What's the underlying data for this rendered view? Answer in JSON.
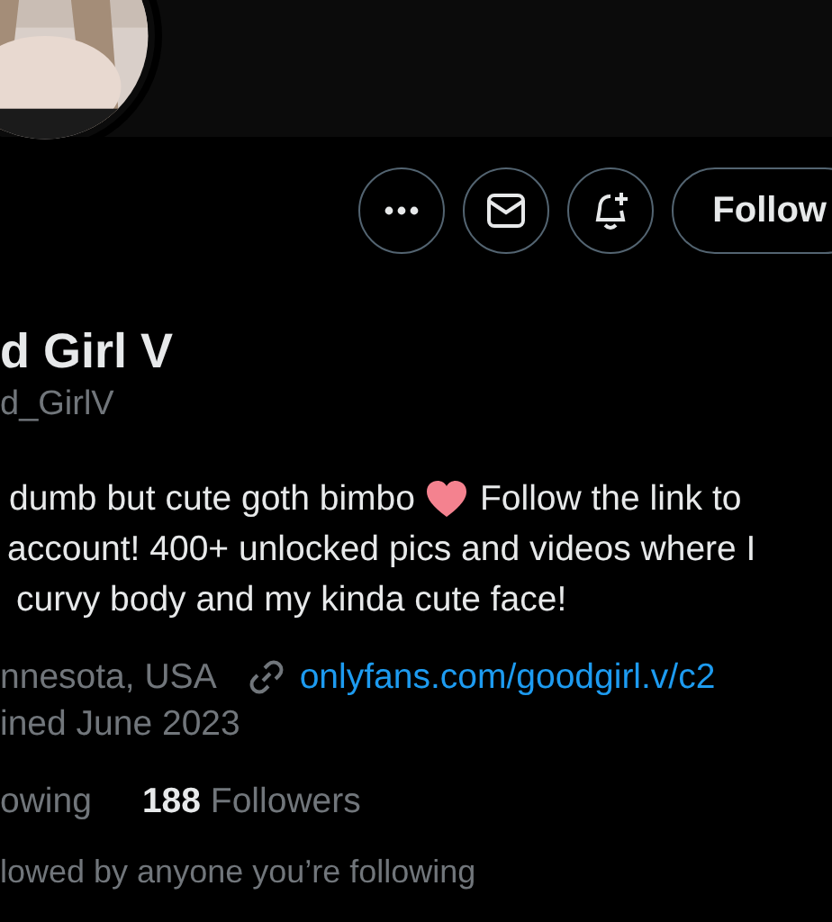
{
  "actions": {
    "follow_label": "Follow"
  },
  "profile": {
    "name": "d Girl V",
    "handle": "d_GirlV",
    "bio_lines": [
      "dumb but cute goth bimbo",
      "account! 400+ unlocked pics and videos where I",
      "curvy body and my kinda cute face!"
    ],
    "bio_after_heart": "Follow the link to",
    "location": "nnesota, USA",
    "link": "onlyfans.com/goodgirl.v/c2",
    "joined": "ined June 2023"
  },
  "stats": {
    "following_label": "owing",
    "followers_count": "188",
    "followers_label": "Followers"
  },
  "followed_by": "lowed by anyone you’re following"
}
